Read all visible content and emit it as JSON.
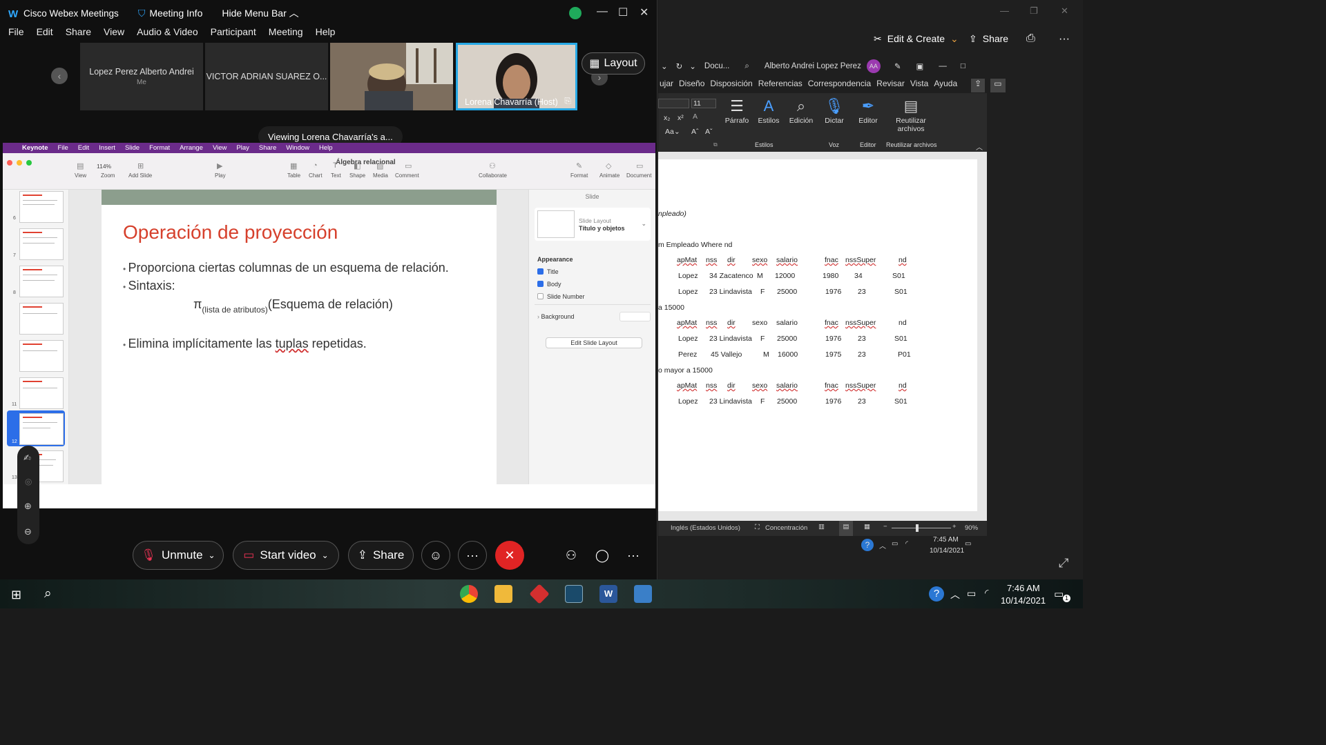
{
  "webex": {
    "app_title": "Cisco Webex Meetings",
    "meeting_info": "Meeting Info",
    "hide_menu_bar": "Hide Menu Bar",
    "menu": [
      "File",
      "Edit",
      "Share",
      "View",
      "Audio & Video",
      "Participant",
      "Meeting",
      "Help"
    ],
    "participants": [
      {
        "name": "Lopez Perez Alberto Andrei",
        "sub": "Me"
      },
      {
        "name": "VICTOR ADRIAN SUAREZ O..."
      },
      {
        "name": ""
      },
      {
        "name": "Lorena Chavarría  (Host)"
      }
    ],
    "layout_label": "Layout",
    "viewing_label": "Viewing Lorena Chavarría's a...",
    "controls": {
      "unmute": "Unmute",
      "start_video": "Start video",
      "share": "Share"
    }
  },
  "keynote": {
    "mac_menu": [
      "Keynote",
      "File",
      "Edit",
      "Insert",
      "Slide",
      "Format",
      "Arrange",
      "View",
      "Play",
      "Share",
      "Window",
      "Help"
    ],
    "doc_title": "Álgebra relacional",
    "toolbar": {
      "zoom_value": "114%",
      "items": [
        "View",
        "Zoom",
        "Add Slide",
        "Play",
        "Table",
        "Chart",
        "Text",
        "Shape",
        "Media",
        "Comment",
        "Collaborate",
        "Format",
        "Animate",
        "Document"
      ]
    },
    "slide_numbers": [
      "6",
      "7",
      "8",
      "11",
      "12",
      "13"
    ],
    "slide": {
      "title": "Operación de proyección",
      "bullet1": "Proporciona ciertas columnas de un esquema de relación.",
      "bullet2": "Sintaxis:",
      "formula_pi": "π",
      "formula_sub": "(lista de atributos)",
      "formula_rest": "(Esquema de relación)",
      "bullet3_a": "Elimina implícitamente las ",
      "bullet3_b": "tuplas",
      "bullet3_c": " repetidas."
    },
    "inspector": {
      "header": "Slide",
      "layout_label": "Slide Layout",
      "layout_value": "Título y objetos",
      "appearance": "Appearance",
      "title_cb": "Title",
      "body_cb": "Body",
      "number_cb": "Slide Number",
      "background": "Background",
      "edit_layout": "Edit Slide Layout"
    }
  },
  "word": {
    "edit_create": "Edit & Create",
    "share": "Share",
    "qat_doc": "Docu...",
    "user_name": "Alberto Andrei Lopez Perez",
    "user_initials": "AA",
    "tabs": [
      "ujar",
      "Diseño",
      "Disposición",
      "Referencias",
      "Correspondencia",
      "Revisar",
      "Vista",
      "Ayuda"
    ],
    "font_size": "11",
    "ribbon": {
      "parrafo": "Párrafo",
      "estilos": "Estilos",
      "edicion": "Edición",
      "dictar": "Dictar",
      "editor": "Editor",
      "reutilizar": "Reutilizar archivos",
      "group_estilos": "Estilos",
      "group_voz": "Voz",
      "group_editor": "Editor",
      "group_reutilizar": "Reutilizar archivos"
    },
    "doc": {
      "line1": "npleado)",
      "line2": "m Empleado Where nd",
      "line_a": "a 15000",
      "line_b": "o mayor a 15000",
      "headers": [
        "apMat",
        "nss",
        "dir",
        "sexo",
        "salario",
        "fnac",
        "nssSuper",
        "nd"
      ],
      "table1": [
        [
          "Lopez",
          "34 Zacatenco",
          "M",
          "12000",
          "1980",
          "34",
          "S01"
        ],
        [
          "Lopez",
          "23 Lindavista",
          "F",
          "25000",
          "1976",
          "23",
          "S01"
        ]
      ],
      "table2": [
        [
          "Lopez",
          "23 Lindavista",
          "F",
          "25000",
          "1976",
          "23",
          "S01"
        ],
        [
          "Perez",
          "45 Vallejo",
          "M",
          "16000",
          "1975",
          "23",
          "P01"
        ]
      ],
      "table3": [
        [
          "Lopez",
          "23 Lindavista",
          "F",
          "25000",
          "1976",
          "23",
          "S01"
        ]
      ]
    },
    "status": {
      "language": "Inglés (Estados Unidos)",
      "focus": "Concentración",
      "zoom": "90%"
    },
    "inner_clock": {
      "time": "7:45 AM",
      "date": "10/14/2021"
    }
  },
  "taskbar": {
    "time": "7:46 AM",
    "date": "10/14/2021",
    "notif_count": "1"
  },
  "colors": {
    "webex_accent": "#2fa8ff",
    "end_call": "#e02424",
    "keynote_title": "#d6402c",
    "active_speaker_border": "#27a9e6"
  }
}
